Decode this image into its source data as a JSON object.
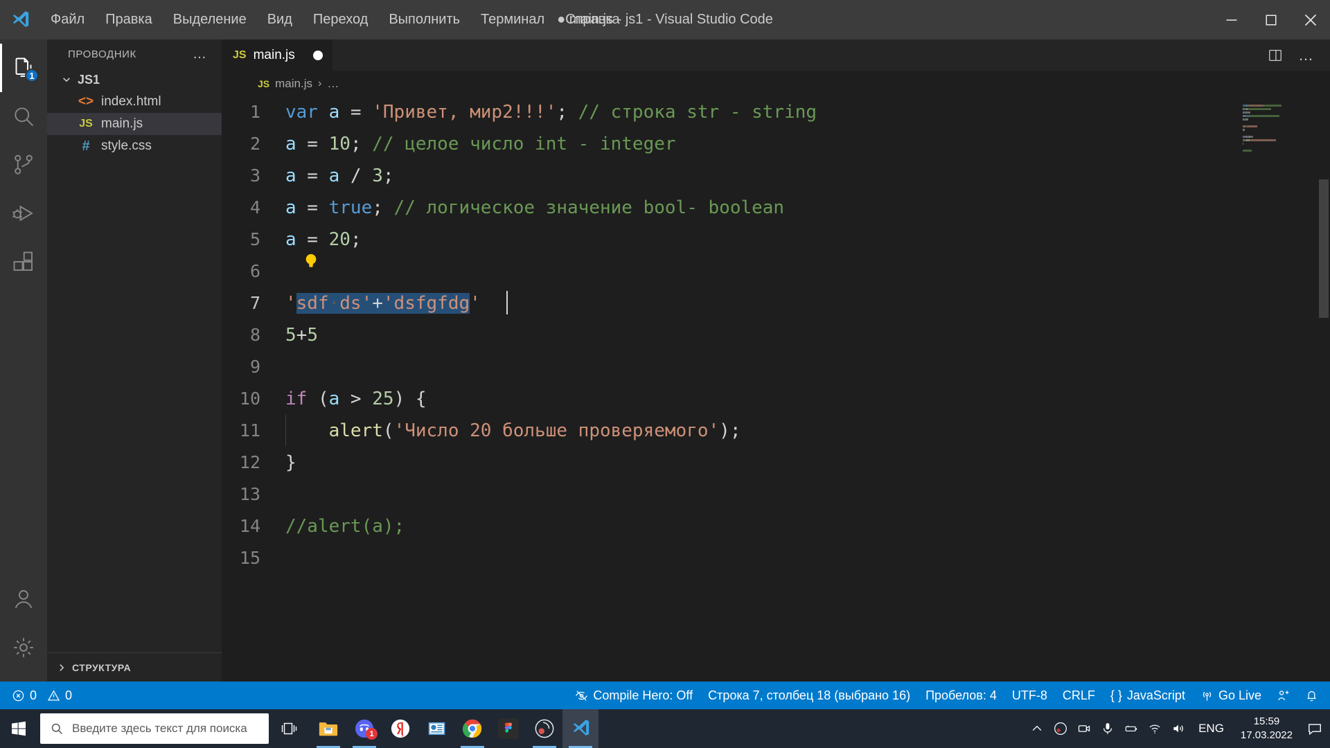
{
  "window": {
    "title": "● main.js - js1 - Visual Studio Code",
    "minimize": "−",
    "maximize": "□",
    "close": "✕"
  },
  "menu": {
    "items": [
      {
        "label": "Файл",
        "name": "menu-file"
      },
      {
        "label": "Правка",
        "name": "menu-edit"
      },
      {
        "label": "Выделение",
        "name": "menu-selection"
      },
      {
        "label": "Вид",
        "name": "menu-view"
      },
      {
        "label": "Переход",
        "name": "menu-go"
      },
      {
        "label": "Выполнить",
        "name": "menu-run"
      },
      {
        "label": "Терминал",
        "name": "menu-terminal"
      },
      {
        "label": "Справка",
        "name": "menu-help"
      }
    ]
  },
  "activity_bar": {
    "items": [
      {
        "icon": "files-explorer-icon",
        "badge": "1",
        "active": true
      },
      {
        "icon": "search-icon",
        "badge": "",
        "active": false
      },
      {
        "icon": "source-control-icon",
        "badge": "",
        "active": false
      },
      {
        "icon": "run-and-debug-icon",
        "badge": "",
        "active": false
      },
      {
        "icon": "extensions-icon",
        "badge": "",
        "active": false
      }
    ],
    "bottom": [
      {
        "icon": "account-icon"
      },
      {
        "icon": "gear-icon"
      }
    ]
  },
  "sidebar": {
    "title": "ПРОВОДНИК",
    "more_actions": "…",
    "folder": "JS1",
    "files": [
      {
        "name": "index.html",
        "icon": "html-file-icon",
        "icon_glyph": "<>",
        "selected": false
      },
      {
        "name": "main.js",
        "icon": "js-file-icon",
        "icon_glyph": "JS",
        "selected": true
      },
      {
        "name": "style.css",
        "icon": "css-file-icon",
        "icon_glyph": "#",
        "selected": false
      }
    ],
    "outline_section": "СТРУКТУРА"
  },
  "tabs": {
    "items": [
      {
        "label": "main.js",
        "icon_glyph": "JS",
        "dirty": true,
        "active": true
      }
    ],
    "split_editor": "split-editor-icon",
    "more_actions": "…"
  },
  "breadcrumb": {
    "file": "main.js",
    "icon_glyph": "JS",
    "separator": "›",
    "rest": "…"
  },
  "editor": {
    "lines": [
      {
        "n": "1",
        "tokens": [
          {
            "t": "var ",
            "c": "kw"
          },
          {
            "t": "a",
            "c": "var"
          },
          {
            "t": " = ",
            "c": "op"
          },
          {
            "t": "'Привет, мир2!!!'",
            "c": "str"
          },
          {
            "t": ";",
            "c": "pun"
          },
          {
            "t": " // строка str - string",
            "c": "com"
          }
        ]
      },
      {
        "n": "2",
        "tokens": [
          {
            "t": "a",
            "c": "var"
          },
          {
            "t": " = ",
            "c": "op"
          },
          {
            "t": "10",
            "c": "num"
          },
          {
            "t": ";",
            "c": "pun"
          },
          {
            "t": " // целое число int - integer",
            "c": "com"
          }
        ]
      },
      {
        "n": "3",
        "tokens": [
          {
            "t": "a",
            "c": "var"
          },
          {
            "t": " = ",
            "c": "op"
          },
          {
            "t": "a",
            "c": "var"
          },
          {
            "t": " / ",
            "c": "op"
          },
          {
            "t": "3",
            "c": "num"
          },
          {
            "t": ";",
            "c": "pun"
          }
        ]
      },
      {
        "n": "4",
        "tokens": [
          {
            "t": "a",
            "c": "var"
          },
          {
            "t": " = ",
            "c": "op"
          },
          {
            "t": "true",
            "c": "kw"
          },
          {
            "t": ";",
            "c": "pun"
          },
          {
            "t": " // логическое значение bool- boolean",
            "c": "com"
          }
        ]
      },
      {
        "n": "5",
        "tokens": [
          {
            "t": "a",
            "c": "var"
          },
          {
            "t": " = ",
            "c": "op"
          },
          {
            "t": "20",
            "c": "num"
          },
          {
            "t": ";",
            "c": "pun"
          }
        ]
      },
      {
        "n": "6",
        "tokens": [],
        "bulb": true
      },
      {
        "n": "7",
        "tokens": [
          {
            "t": "'",
            "c": "str"
          },
          {
            "t": "sdf",
            "c": "str",
            "sel": true
          },
          {
            "t": "·",
            "c": "ws",
            "sel": true
          },
          {
            "t": "ds'",
            "c": "str",
            "sel": true
          },
          {
            "t": "+",
            "c": "op",
            "sel": true
          },
          {
            "t": "'dsfgfdg",
            "c": "str",
            "sel": true
          },
          {
            "t": "'",
            "c": "str"
          }
        ],
        "current": true
      },
      {
        "n": "8",
        "tokens": [
          {
            "t": "5",
            "c": "num"
          },
          {
            "t": "+",
            "c": "op"
          },
          {
            "t": "5",
            "c": "num"
          }
        ]
      },
      {
        "n": "9",
        "tokens": []
      },
      {
        "n": "10",
        "tokens": [
          {
            "t": "if",
            "c": "kw2"
          },
          {
            "t": " (",
            "c": "pun"
          },
          {
            "t": "a",
            "c": "var"
          },
          {
            "t": " > ",
            "c": "op"
          },
          {
            "t": "25",
            "c": "num"
          },
          {
            "t": ") {",
            "c": "pun"
          }
        ]
      },
      {
        "n": "11",
        "tokens": [
          {
            "t": "    ",
            "c": "op"
          },
          {
            "t": "alert",
            "c": "fn"
          },
          {
            "t": "(",
            "c": "pun"
          },
          {
            "t": "'Число 20 больше проверяемого'",
            "c": "str"
          },
          {
            "t": ");",
            "c": "pun"
          }
        ],
        "indent": true
      },
      {
        "n": "12",
        "tokens": [
          {
            "t": "}",
            "c": "pun"
          }
        ]
      },
      {
        "n": "13",
        "tokens": []
      },
      {
        "n": "14",
        "tokens": [
          {
            "t": "//alert(a);",
            "c": "com"
          }
        ]
      },
      {
        "n": "15",
        "tokens": []
      }
    ]
  },
  "statusbar": {
    "errors_icon": "error-circle-icon",
    "errors": "0",
    "warnings_icon": "warning-triangle-icon",
    "warnings": "0",
    "compile_hero_icon": "eye-off-icon",
    "compile_hero": "Compile Hero: Off",
    "cursor_position": "Строка 7, столбец 18 (выбрано 16)",
    "indentation": "Пробелов: 4",
    "encoding": "UTF-8",
    "eol": "CRLF",
    "language_icon": "{ }",
    "language": "JavaScript",
    "go_live_icon": "broadcast-icon",
    "go_live": "Go Live",
    "remote_icon": "remote-person-icon",
    "bell_icon": "bell-icon"
  },
  "taskbar": {
    "start_icon": "windows-start-icon",
    "search_icon": "search-icon",
    "search_placeholder": "Введите здесь текст для поиска",
    "task_view_icon": "task-view-icon",
    "apps": [
      {
        "name": "file-explorer",
        "label": "Проводник",
        "running": true,
        "badge": ""
      },
      {
        "name": "discord",
        "label": "Discord",
        "running": true,
        "badge": "1"
      },
      {
        "name": "yandex-browser",
        "label": "Яндекс.Браузер",
        "running": false,
        "badge": ""
      },
      {
        "name": "powerpoint",
        "label": "PowerPoint",
        "running": false,
        "badge": ""
      },
      {
        "name": "google-chrome",
        "label": "Google Chrome",
        "running": true,
        "badge": ""
      },
      {
        "name": "figma",
        "label": "Figma",
        "running": false,
        "badge": ""
      },
      {
        "name": "obs-studio",
        "label": "OBS Studio",
        "running": true,
        "badge": ""
      },
      {
        "name": "visual-studio-code",
        "label": "Visual Studio Code",
        "running": true,
        "badge": "",
        "active": true
      }
    ],
    "tray": {
      "chevron": "show-hidden-icons-icon",
      "icons": [
        "obs-tray-icon",
        "camera-icon",
        "microphone-icon",
        "battery-icon",
        "wifi-icon",
        "volume-icon"
      ],
      "language": "ENG",
      "time": "15:59",
      "date": "17.03.2022",
      "notifications_icon": "notification-center-icon"
    }
  },
  "colors": {
    "accent": "#007acc",
    "titlebar": "#3c3c3c",
    "sidebar": "#252526",
    "editor": "#1e1e1e",
    "activity": "#333333",
    "selection": "#264f78",
    "taskbar": "#1f2733"
  }
}
